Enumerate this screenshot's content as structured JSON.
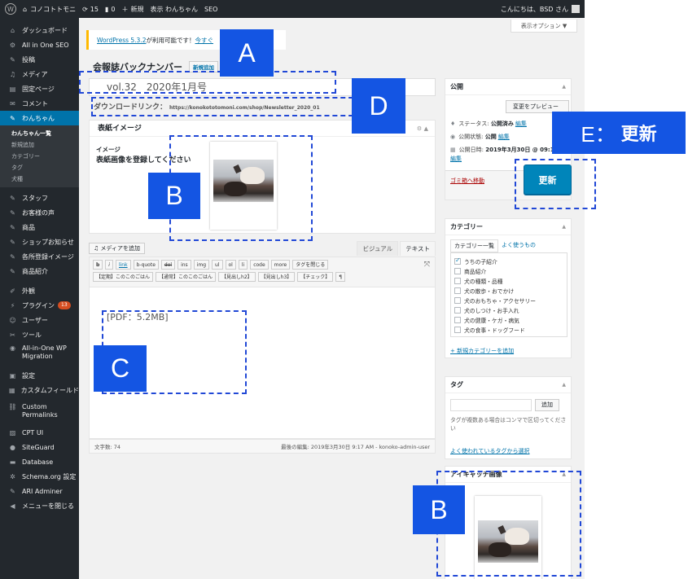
{
  "admin_bar": {
    "wp_logo": "wordpress-logo",
    "site_name": "コノコトトモニ",
    "updates_count": "15",
    "comments_count": "0",
    "new_label": "新規",
    "view_label": "表示 わんちゃん",
    "seo_label": "SEO",
    "greeting": "こんにちは、BSD さん"
  },
  "sidebar": {
    "items": [
      {
        "icon": "dashboard-icon",
        "glyph": "⌂",
        "label": "ダッシュボード"
      },
      {
        "icon": "gear-icon",
        "glyph": "⚙",
        "label": "All in One SEO"
      },
      {
        "icon": "pin-icon",
        "glyph": "✎",
        "label": "投稿"
      },
      {
        "icon": "media-icon",
        "glyph": "♫",
        "label": "メディア"
      },
      {
        "icon": "page-icon",
        "glyph": "▤",
        "label": "固定ページ"
      },
      {
        "icon": "comment-icon",
        "glyph": "✉",
        "label": "コメント"
      },
      {
        "icon": "pin-icon",
        "glyph": "✎",
        "label": "わんちゃん"
      }
    ],
    "submenu": [
      "わんちゃん一覧",
      "新規追加",
      "カテゴリー",
      "タグ",
      "犬種"
    ],
    "items2": [
      {
        "icon": "pin-icon",
        "glyph": "✎",
        "label": "スタッフ"
      },
      {
        "icon": "pin-icon",
        "glyph": "✎",
        "label": "お客様の声"
      },
      {
        "icon": "pin-icon",
        "glyph": "✎",
        "label": "商品"
      },
      {
        "icon": "pin-icon",
        "glyph": "✎",
        "label": "ショップお知らせ"
      },
      {
        "icon": "pin-icon",
        "glyph": "✎",
        "label": "各所登録イメージ"
      },
      {
        "icon": "pin-icon",
        "glyph": "✎",
        "label": "商品紹介"
      }
    ],
    "items3": [
      {
        "icon": "brush-icon",
        "glyph": "✐",
        "label": "外観"
      },
      {
        "icon": "plugin-icon",
        "glyph": "⚡",
        "label": "プラグイン",
        "badge": "13"
      },
      {
        "icon": "user-icon",
        "glyph": "☺",
        "label": "ユーザー"
      },
      {
        "icon": "tools-icon",
        "glyph": "✂",
        "label": "ツール"
      }
    ],
    "migration_label": "All-in-One WP Migration",
    "items4": [
      {
        "icon": "settings-icon",
        "glyph": "▣",
        "label": "設定"
      },
      {
        "icon": "custom-field-icon",
        "glyph": "▦",
        "label": "カスタムフィールド"
      }
    ],
    "permalinks_label": "Custom Permalinks",
    "items5": [
      {
        "icon": "cpt-icon",
        "glyph": "▨",
        "label": "CPT UI"
      },
      {
        "icon": "siteguard-icon",
        "glyph": "●",
        "label": "SiteGuard"
      },
      {
        "icon": "database-icon",
        "glyph": "▬",
        "label": "Database"
      },
      {
        "icon": "schema-icon",
        "glyph": "✲",
        "label": "Schema.org 設定"
      },
      {
        "icon": "wrench-icon",
        "glyph": "✎",
        "label": "ARI Adminer"
      },
      {
        "icon": "collapse-icon",
        "glyph": "◀",
        "label": "メニューを閉じる"
      }
    ]
  },
  "main": {
    "screen_options": "表示オプション ▼",
    "notice_link": "WordPress 5.3.2",
    "notice_text": " が利用可能です！",
    "notice_link2": "今すぐ",
    "page_title": "会報誌バックナンバー",
    "add_new": "新規追加",
    "post_title": "vol.32　2020年1月号",
    "download_label": "ダウンロードリンク：",
    "download_url": "https://konokototomoni.com/shop/Newsletter_2020_01",
    "cover_box_title": "表紙イメージ",
    "cover_label1": "イメージ",
    "cover_label2": "表紙画像を登録してください",
    "add_media": "メディアを追加",
    "tab_visual": "ビジュアル",
    "tab_text": "テキスト",
    "quicktags_row1": [
      "b",
      "i",
      "link",
      "b-quote",
      "del",
      "ins",
      "img",
      "ul",
      "ol",
      "li",
      "code",
      "more",
      "タグを閉じる"
    ],
    "quicktags_row2": [
      "【定期】このこのごはん",
      "【通常】このこのごはん",
      "【見出しh2】",
      "【見出しh3】",
      "【チェック】",
      "¶"
    ],
    "content": "[PDF：5.2MB]",
    "word_count": "文字数: 74",
    "last_edit": "最後の編集: 2019年3月30日 9:17 AM - konoko-admin-user"
  },
  "publish": {
    "title": "公開",
    "preview": "変更をプレビュー",
    "status_label": "ステータス: ",
    "status_value": "公開済み",
    "status_edit": "編集",
    "visibility_label": "公開状態: ",
    "visibility_value": "公開",
    "visibility_edit": "編集",
    "date_label": "公開日時: ",
    "date_value": "2019年3月30日 @ 09:1",
    "date_edit": "編集",
    "trash": "ゴミ箱へ移動",
    "update": "更新"
  },
  "category": {
    "title": "カテゴリー",
    "tab_all": "カテゴリー一覧",
    "tab_popular": "よく使うもの",
    "items": [
      {
        "label": "うちの子紹介",
        "checked": true
      },
      {
        "label": "商品紹介",
        "checked": false
      },
      {
        "label": "犬の種類・品種",
        "checked": false
      },
      {
        "label": "犬の散歩・おでかけ",
        "checked": false
      },
      {
        "label": "犬のおもちゃ・アクセサリー",
        "checked": false
      },
      {
        "label": "犬のしつけ・お手入れ",
        "checked": false
      },
      {
        "label": "犬の健康・ケガ・病気",
        "checked": false
      },
      {
        "label": "犬の食事・ドッグフード",
        "checked": false
      }
    ],
    "add_new": "+ 新規カテゴリーを追加"
  },
  "tags": {
    "title": "タグ",
    "add": "追加",
    "help": "タグが複数ある場合はコンマで区切ってください",
    "choose": "よく使われているタグから選択"
  },
  "thumbnail": {
    "title": "アイキャッチ画像"
  },
  "annotations": {
    "A": "A",
    "B": "B",
    "C": "C",
    "D": "D",
    "E": "E：",
    "E_word": "更新"
  }
}
